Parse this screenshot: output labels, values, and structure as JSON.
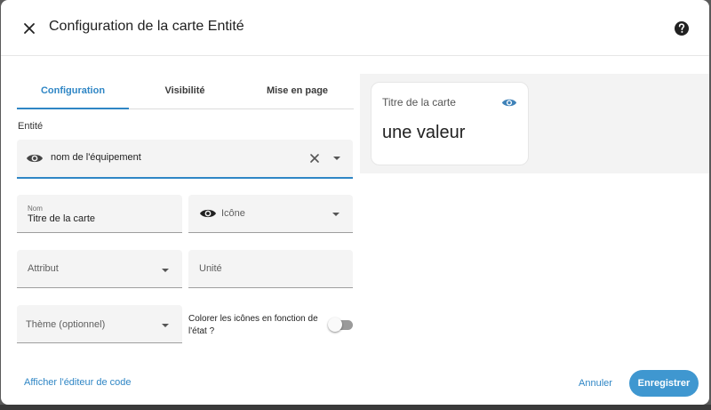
{
  "dialog": {
    "title": "Configuration de la carte Entité",
    "close_icon": "close-icon",
    "help_icon": "help-circle-icon"
  },
  "tabs": [
    {
      "label": "Configuration",
      "active": true
    },
    {
      "label": "Visibilité",
      "active": false
    },
    {
      "label": "Mise en page",
      "active": false
    }
  ],
  "form": {
    "entity_label": "Entité",
    "entity_value": "nom de l'équipement",
    "name_label": "Nom",
    "name_value": "Titre de la carte",
    "icon_label": "Icône",
    "attribute_label": "Attribut",
    "unit_label": "Unité",
    "theme_label": "Thème (optionnel)",
    "state_color_label": "Colorer les icônes en fonction de l'état ?",
    "state_color_enabled": false
  },
  "preview": {
    "card_title": "Titre de la carte",
    "card_value": "une valeur"
  },
  "footer": {
    "code_editor_label": "Afficher l'éditeur de code",
    "cancel_label": "Annuler",
    "save_label": "Enregistrer"
  },
  "colors": {
    "accent": "#2f86c5",
    "primary_button": "#3f97d0",
    "field_background": "#f4f4f4",
    "preview_background": "#f3f3f3"
  }
}
